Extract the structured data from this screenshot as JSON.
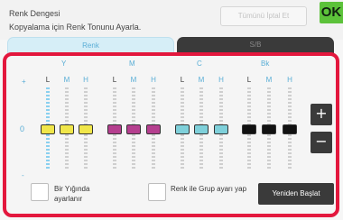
{
  "header": {
    "title_line1": "Renk Dengesi",
    "title_line2": "Kopyalama için Renk Tonunu Ayarla.",
    "cancel_all_label": "Tümünü İptal Et",
    "ok_label": "OK"
  },
  "tabs": [
    {
      "label": "Renk",
      "active": true
    },
    {
      "label": "S/B",
      "active": false
    }
  ],
  "scale": {
    "top_mark": "+",
    "zero_label": "0",
    "bottom_mark": "-"
  },
  "groups": [
    {
      "label": "Y",
      "handle_color": "#f0e64a",
      "columns": [
        "L",
        "M",
        "H"
      ]
    },
    {
      "label": "M",
      "handle_color": "#b53f8f",
      "columns": [
        "L",
        "M",
        "H"
      ]
    },
    {
      "label": "C",
      "handle_color": "#7fd0da",
      "columns": [
        "L",
        "M",
        "H"
      ]
    },
    {
      "label": "Bk",
      "handle_color": "#111111",
      "columns": [
        "L",
        "M",
        "H"
      ]
    }
  ],
  "controls": {
    "plus_label": "+",
    "minus_label": "−"
  },
  "footer": {
    "bulk_adjust_label_line1": "Bir Yığında",
    "bulk_adjust_label_line2": "ayarlanır",
    "group_adjust_label": "Renk ile Grup ayarı yap",
    "restart_label": "Yeniden Başlat"
  },
  "colors": {
    "accent": "#5aaed6",
    "highlight_frame": "#e3173d",
    "ok_green": "#5cc23a"
  }
}
